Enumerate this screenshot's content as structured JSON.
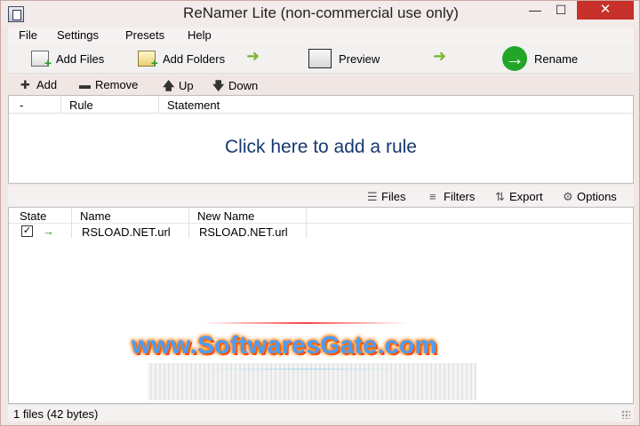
{
  "window": {
    "title": "ReNamer Lite (non-commercial use only)",
    "controls": {
      "minimize": "—",
      "maximize": "☐",
      "close": "✕"
    }
  },
  "menu": [
    "File",
    "Settings",
    "Presets",
    "Help"
  ],
  "toolbar": {
    "add_files": "Add Files",
    "add_folders": "Add Folders",
    "preview": "Preview",
    "rename": "Rename"
  },
  "rule_toolbar": {
    "add": "Add",
    "remove": "Remove",
    "up": "Up",
    "down": "Down"
  },
  "rules_table": {
    "columns": [
      "-",
      "Rule",
      "Statement"
    ],
    "empty_prompt": "Click here to add a rule"
  },
  "files_toolbar": {
    "files": "Files",
    "filters": "Filters",
    "export": "Export",
    "options": "Options"
  },
  "files_table": {
    "columns": [
      "State",
      "Name",
      "New Name"
    ],
    "rows": [
      {
        "checked": true,
        "state_icon": "→",
        "name": "RSLOAD.NET.url",
        "new_name": "RSLOAD.NET.url"
      }
    ]
  },
  "watermark": {
    "text": "www.SoftwaresGate.com"
  },
  "statusbar": {
    "text": "1 files (42 bytes)"
  },
  "colors": {
    "accent_blue": "#16386f",
    "green": "#23a528",
    "close_red": "#c7302b"
  }
}
